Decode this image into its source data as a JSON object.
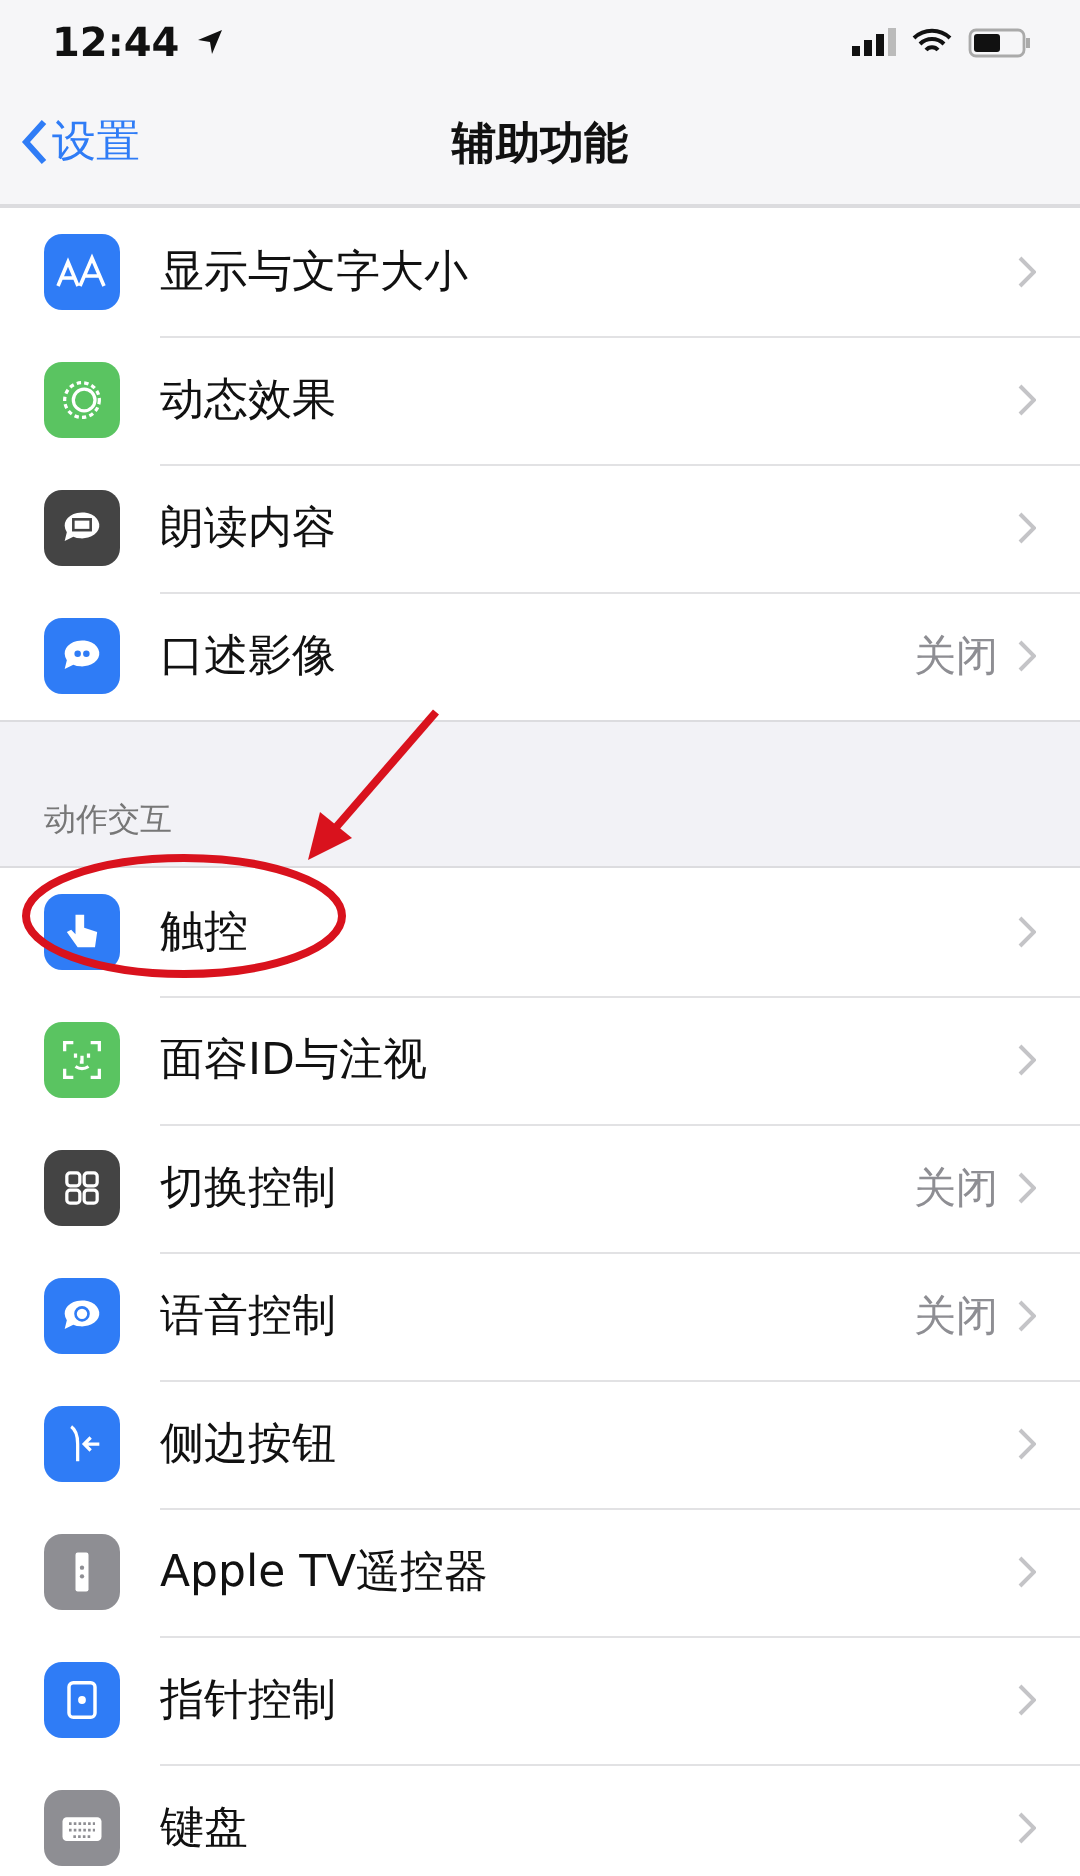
{
  "status_bar": {
    "time": "12:44"
  },
  "nav": {
    "back": "设置",
    "title": "辅助功能"
  },
  "sections": [
    {
      "items": [
        {
          "label": "显示与文字大小"
        },
        {
          "label": "动态效果"
        },
        {
          "label": "朗读内容"
        },
        {
          "label": "口述影像",
          "detail": "关闭"
        }
      ]
    },
    {
      "header": "动作交互",
      "items": [
        {
          "label": "触控"
        },
        {
          "label": "面容ID与注视"
        },
        {
          "label": "切换控制",
          "detail": "关闭"
        },
        {
          "label": "语音控制",
          "detail": "关闭"
        },
        {
          "label": "侧边按钮"
        },
        {
          "label": "Apple TV遥控器"
        },
        {
          "label": "指针控制"
        },
        {
          "label": "键盘"
        }
      ]
    }
  ]
}
